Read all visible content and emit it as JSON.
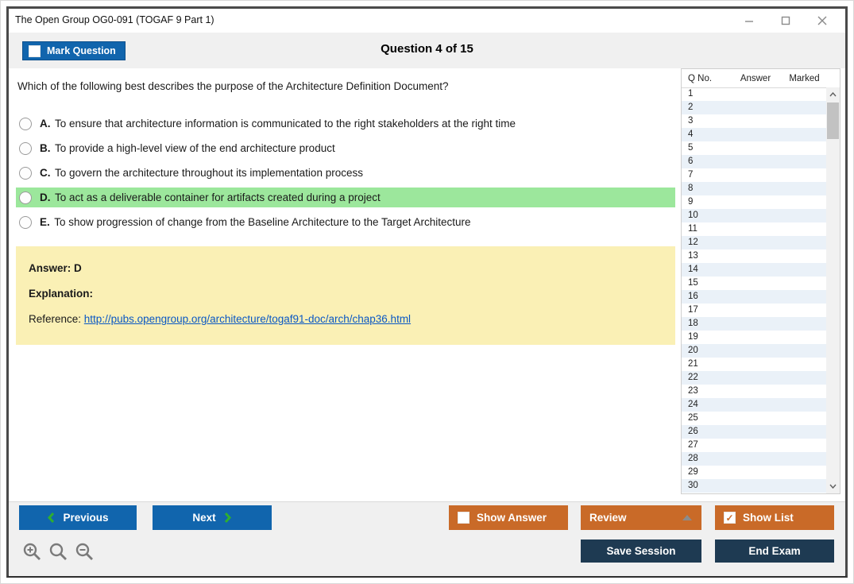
{
  "window": {
    "title": "The Open Group OG0-091 (TOGAF 9 Part 1)"
  },
  "header": {
    "mark_question_label": "Mark Question",
    "question_counter": "Question 4 of 15"
  },
  "question": {
    "text": "Which of the following best describes the purpose of the Architecture Definition Document?",
    "options": [
      {
        "letter": "A.",
        "text": "To ensure that architecture information is communicated to the right stakeholders at the right time",
        "highlighted": false
      },
      {
        "letter": "B.",
        "text": "To provide a high-level view of the end architecture product",
        "highlighted": false
      },
      {
        "letter": "C.",
        "text": "To govern the architecture throughout its implementation process",
        "highlighted": false
      },
      {
        "letter": "D.",
        "text": "To act as a deliverable container for artifacts created during a project",
        "highlighted": true
      },
      {
        "letter": "E.",
        "text": "To show progression of change from the Baseline Architecture to the Target Architecture",
        "highlighted": false
      }
    ]
  },
  "answer_panel": {
    "answer_label": "Answer: D",
    "explanation_label": "Explanation:",
    "reference_prefix": "Reference: ",
    "reference_link": "http://pubs.opengroup.org/architecture/togaf91-doc/arch/chap36.html"
  },
  "question_list": {
    "columns": [
      "Q No.",
      "Answer",
      "Marked"
    ],
    "rows": [
      "1",
      "2",
      "3",
      "4",
      "5",
      "6",
      "7",
      "8",
      "9",
      "10",
      "11",
      "12",
      "13",
      "14",
      "15",
      "16",
      "17",
      "18",
      "19",
      "20",
      "21",
      "22",
      "23",
      "24",
      "25",
      "26",
      "27",
      "28",
      "29",
      "30"
    ]
  },
  "footer": {
    "previous_label": "Previous",
    "next_label": "Next",
    "show_answer_label": "Show Answer",
    "review_label": "Review",
    "show_list_label": "Show List",
    "save_session_label": "Save Session",
    "end_exam_label": "End Exam"
  },
  "colors": {
    "blue": "#1165ad",
    "orange": "#c96a28",
    "navy": "#1e3a52",
    "chev-green": "#2faf2f",
    "hl-green": "#9ce79c",
    "yellow": "#faf0b5",
    "row-alt": "#eaf1f8"
  }
}
